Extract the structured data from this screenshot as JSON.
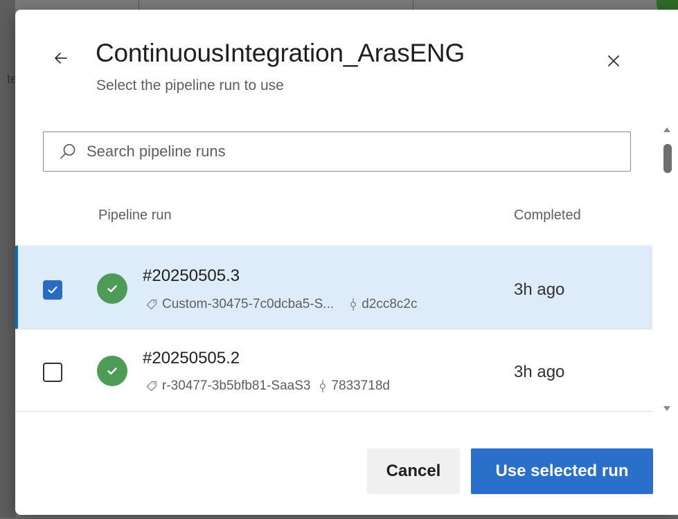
{
  "dialog": {
    "title": "ContinuousIntegration_ArasENG",
    "subtitle": "Select the pipeline run to use",
    "search": {
      "placeholder": "Search pipeline runs",
      "value": ""
    },
    "columns": {
      "pipeline_run": "Pipeline run",
      "completed": "Completed"
    },
    "runs": [
      {
        "id": "#20250505.3",
        "branch": "Custom-30475-7c0dcba5-S...",
        "commit": "d2cc8c2c",
        "completed": "3h ago",
        "selected": true,
        "status": "succeeded"
      },
      {
        "id": "#20250505.2",
        "branch": "r-30477-3b5bfb81-SaaS3",
        "commit": "7833718d",
        "completed": "3h ago",
        "selected": false,
        "status": "succeeded"
      }
    ],
    "buttons": {
      "cancel": "Cancel",
      "primary": "Use selected run"
    }
  },
  "colors": {
    "accent": "#2a6fc9",
    "selected_row": "#deecf9",
    "success": "#4e9a57"
  },
  "icons": {
    "back": "arrow-left-icon",
    "close": "close-icon",
    "search": "search-icon",
    "tag": "tag-icon",
    "commit": "commit-icon",
    "status": "check-circle-icon",
    "checkbox": "checkmark-icon"
  }
}
